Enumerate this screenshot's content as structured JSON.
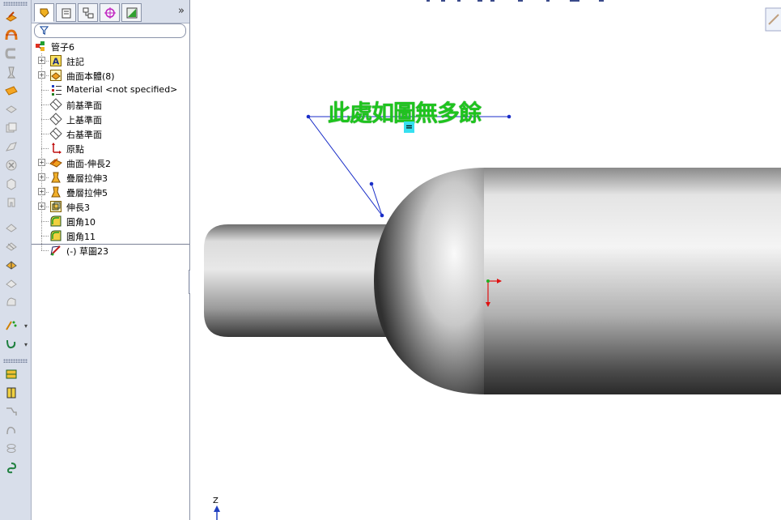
{
  "command_toolbar": {
    "icons": [
      "extruded-surface-icon",
      "revolved-surface-icon",
      "swept-surface-icon",
      "lofted-surface-icon",
      "boundary-surface-icon",
      "offset-surface-icon",
      "radiate-surface-icon",
      "ruled-surface-icon",
      "extend-surface-icon",
      "trim-surface-icon",
      "untrim-surface-icon",
      "knit-surface-icon",
      "fill-surface-icon",
      "thicken-icon",
      "cut-with-surface-icon",
      "delete-face-icon",
      "replace-face-icon",
      "freeform-icon",
      "curves-icon"
    ],
    "bottom_icons": [
      "split-line-icon",
      "projected-curve-icon",
      "composite-curve-icon",
      "curve-through-points-icon",
      "helix-icon",
      "spiral-icon"
    ]
  },
  "feature_manager": {
    "tabs": [
      "featuremanager-tab",
      "propertymanager-tab",
      "configurationmanager-tab",
      "dimxpert-tab",
      "display-manager-tab"
    ],
    "more_label": "»",
    "tree": [
      {
        "label": "管子6",
        "icon": "part-icon",
        "expandable": false,
        "indent": 0
      },
      {
        "label": "註記",
        "icon": "annotations-icon",
        "expandable": true,
        "indent": 1
      },
      {
        "label": "曲面本體(8)",
        "icon": "surface-bodies-icon",
        "expandable": true,
        "indent": 1
      },
      {
        "label": "Material <not specified>",
        "icon": "material-icon",
        "expandable": false,
        "indent": 1
      },
      {
        "label": "前基準面",
        "icon": "plane-icon",
        "expandable": false,
        "indent": 1
      },
      {
        "label": "上基準面",
        "icon": "plane-icon",
        "expandable": false,
        "indent": 1
      },
      {
        "label": "右基準面",
        "icon": "plane-icon",
        "expandable": false,
        "indent": 1
      },
      {
        "label": "原點",
        "icon": "origin-icon",
        "expandable": false,
        "indent": 1
      },
      {
        "label": "曲面-伸長2",
        "icon": "extrude-surface-feature-icon",
        "expandable": true,
        "indent": 1
      },
      {
        "label": "疊層拉伸3",
        "icon": "loft-feature-icon",
        "expandable": true,
        "indent": 1
      },
      {
        "label": "疊層拉伸5",
        "icon": "loft-feature-icon",
        "expandable": true,
        "indent": 1
      },
      {
        "label": "伸長3",
        "icon": "extrude-feature-icon",
        "expandable": true,
        "indent": 1
      },
      {
        "label": "圓角10",
        "icon": "fillet-feature-icon",
        "expandable": false,
        "indent": 1
      },
      {
        "label": "圓角11",
        "icon": "fillet-feature-icon",
        "expandable": false,
        "indent": 1
      },
      {
        "label": "(-) 草圖23",
        "icon": "sketch-icon",
        "expandable": false,
        "indent": 1
      }
    ]
  },
  "graphics": {
    "note_text": "此處如圖無多餘",
    "note_color": "#1ec41e",
    "box_text": "=",
    "axis_label": "Z"
  }
}
